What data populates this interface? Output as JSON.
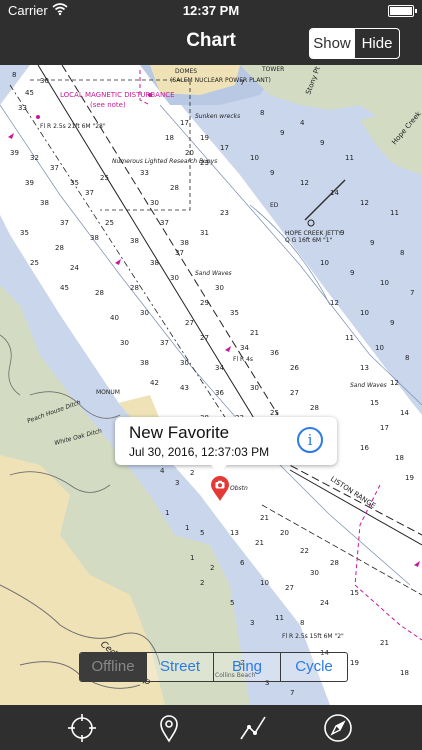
{
  "status_bar": {
    "carrier": "Carrier",
    "time": "12:37 PM"
  },
  "nav": {
    "title": "Chart",
    "show_label": "Show",
    "hide_label": "Hide",
    "selected": "Show"
  },
  "map": {
    "labels": {
      "disturbance": "LOCAL MAGNETIC DISTURBANCE",
      "see_note": "(see note)",
      "domes": "DOMES",
      "power_plant": "(SALEM NUCLEAR POWER PLANT)",
      "tower": "TOWER",
      "stony_pt": "Stony Pt",
      "hope_creek": "Hope Creek",
      "hope_creek_jetty": "HOPE CREEK JETTY",
      "jetty_light": "Q G 16ft 6M \"1\"",
      "sand_waves_1": "Sand Waves",
      "sand_waves_2": "Sand Waves",
      "sunken_wreck": "Sunken wrecks",
      "fl_r_left": "Fl R 2.5s 21ft 6M \"28\"",
      "fl_r_mid": "Fl R 4s",
      "numerous": "Numerous Lighted Research Buoys",
      "peach_house": "Peach House Ditch",
      "white_oak": "White Oak Ditch",
      "cedar_swamp": "Cedar Swamp",
      "liston_range": "LISTON RANGE",
      "fl_r_bottom": "Fl R 2.5s 15ft 6M \"2\"",
      "collins": "Collins Beach",
      "obstn": "Obstn",
      "monument": "MONUM",
      "ed": "ED"
    },
    "colors": {
      "deep_water": "#ffffff",
      "shallow_water": "#c9d6ec",
      "land": "#efe2b6",
      "marsh": "#d3dbc3",
      "magenta": "#c8199a"
    }
  },
  "callout": {
    "title": "New Favorite",
    "subtitle": "Jul 30, 2016, 12:37:03 PM"
  },
  "layers": {
    "options": [
      "Offline",
      "Street",
      "Bing",
      "Cycle"
    ],
    "selected": "Offline"
  },
  "toolbar": {
    "icons": [
      "locate-crosshair-icon",
      "map-pin-icon",
      "route-icon",
      "compass-icon"
    ]
  }
}
